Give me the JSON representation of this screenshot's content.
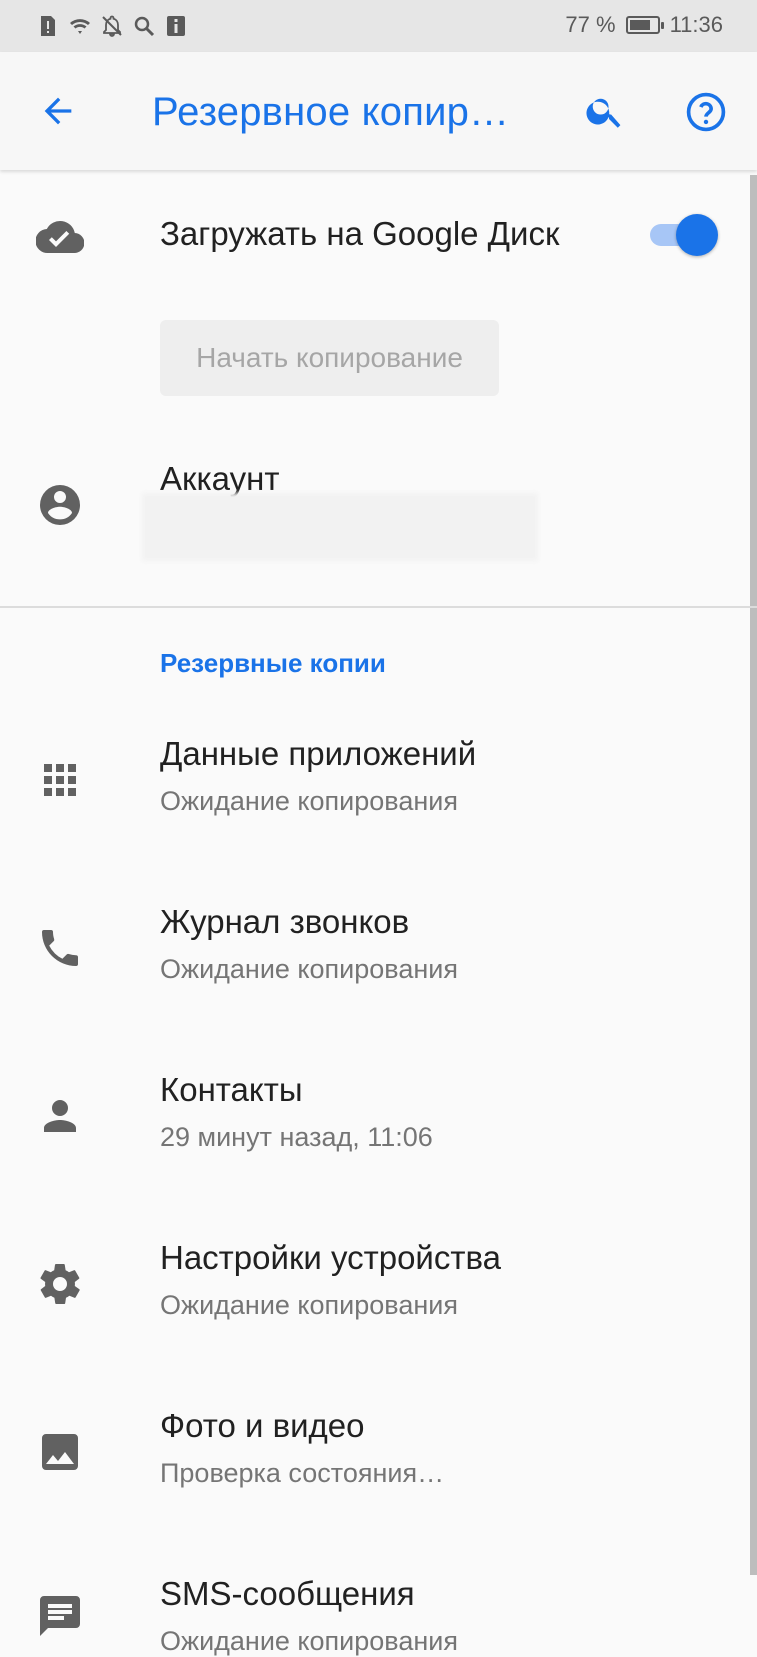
{
  "status_bar": {
    "battery_percent": "77 %",
    "time": "11:36",
    "battery_level": 0.77,
    "icons": [
      "alert-icon",
      "wifi-icon",
      "notifications-off-icon",
      "search-icon",
      "info-icon"
    ]
  },
  "app_bar": {
    "title": "Резервное копир…",
    "icons": [
      "back-arrow-icon",
      "search-icon",
      "help-icon"
    ]
  },
  "upload": {
    "label": "Загружать на Google Диск",
    "enabled": true,
    "icon": "cloud-done-icon"
  },
  "start_button": {
    "label": "Начать копирование"
  },
  "account": {
    "label": "Аккаунт",
    "icon": "account-circle-icon"
  },
  "backups": {
    "header": "Резервные копии",
    "items": [
      {
        "title": "Данные приложений",
        "subtitle": "Ожидание копирования",
        "icon": "apps-grid-icon"
      },
      {
        "title": "Журнал звонков",
        "subtitle": "Ожидание копирования",
        "icon": "phone-icon"
      },
      {
        "title": "Контакты",
        "subtitle": "29 минут назад, 11:06",
        "icon": "person-icon"
      },
      {
        "title": "Настройки устройства",
        "subtitle": "Ожидание копирования",
        "icon": "settings-gear-icon"
      },
      {
        "title": "Фото и видео",
        "subtitle": "Проверка состояния…",
        "icon": "image-icon"
      },
      {
        "title": "SMS-сообщения",
        "subtitle": "Ожидание копирования",
        "icon": "message-icon"
      }
    ]
  },
  "colors": {
    "accent": "#1a73e8",
    "icon_gray": "#616161",
    "text_primary": "#212121",
    "text_secondary": "#757575"
  }
}
